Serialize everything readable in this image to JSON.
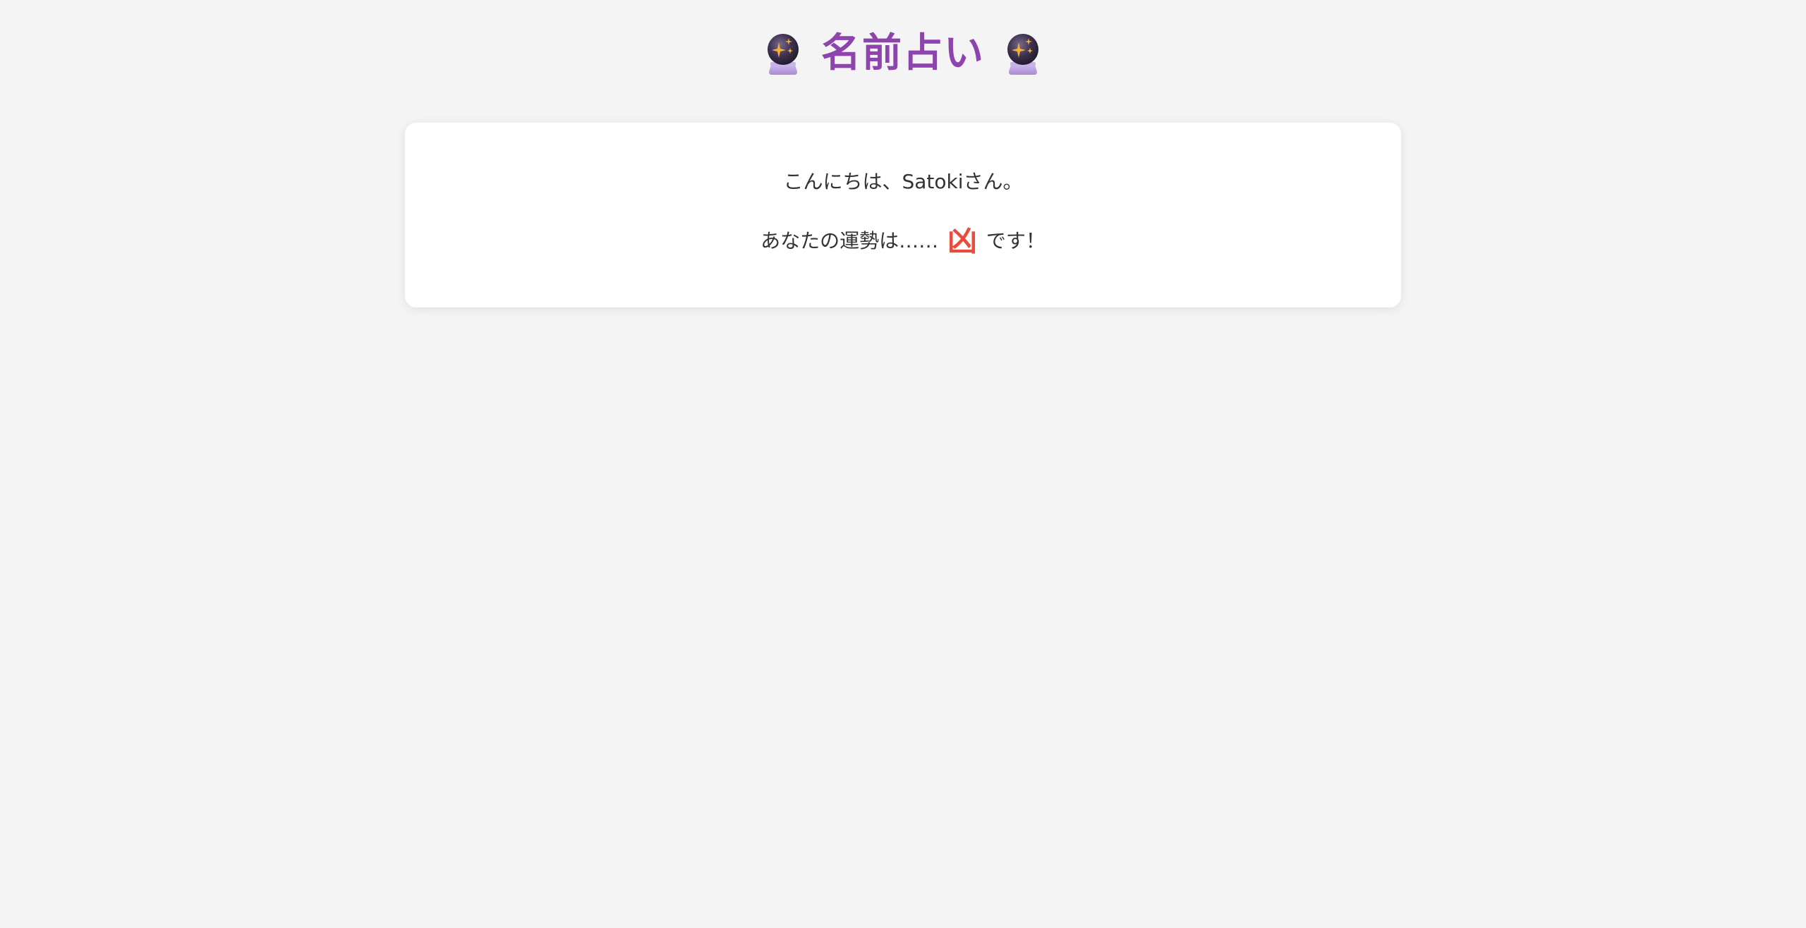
{
  "header": {
    "title": "名前占い",
    "left_icon": "crystal-ball-icon",
    "right_icon": "crystal-ball-icon"
  },
  "result_card": {
    "greeting": "こんにちは、Satokiさん。",
    "fortune_prefix": "あなたの運勢は……",
    "fortune_result": "凶",
    "fortune_suffix": "です！"
  },
  "colors": {
    "background": "#f4f4f4",
    "title": "#8e44ad",
    "result": "#e74c3c",
    "text": "#333333",
    "card": "#ffffff"
  }
}
